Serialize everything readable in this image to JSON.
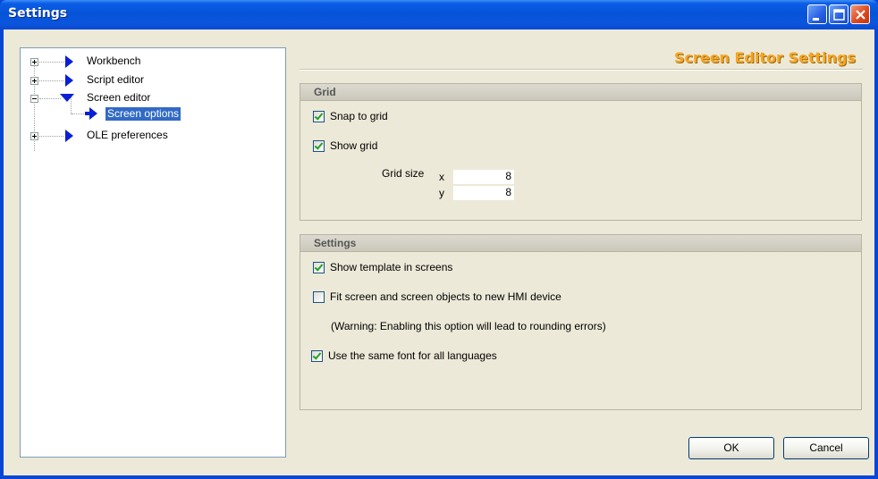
{
  "window": {
    "title": "Settings"
  },
  "tree": {
    "items": [
      {
        "label": "Workbench",
        "expander": "plus"
      },
      {
        "label": "Script editor",
        "expander": "plus"
      },
      {
        "label": "Screen editor",
        "expander": "minus"
      },
      {
        "label": "Screen options",
        "selected": true
      },
      {
        "label": "OLE preferences",
        "expander": "plus"
      }
    ]
  },
  "page": {
    "title": "Screen Editor Settings"
  },
  "grid_group": {
    "title": "Grid",
    "snap_to_grid": {
      "label": "Snap to grid",
      "checked": true
    },
    "show_grid": {
      "label": "Show grid",
      "checked": true
    },
    "grid_size_label": "Grid size",
    "x_label": "x",
    "y_label": "y",
    "x_value": "8",
    "y_value": "8"
  },
  "settings_group": {
    "title": "Settings",
    "show_template": {
      "label": "Show template in screens",
      "checked": true
    },
    "fit_screen": {
      "label": "Fit screen and screen objects to new HMI device",
      "checked": false
    },
    "warning": "(Warning: Enabling this option will lead to rounding errors)",
    "same_font": {
      "label": "Use the same font for all languages",
      "checked": true
    }
  },
  "buttons": {
    "ok": "OK",
    "cancel": "Cancel"
  },
  "colors": {
    "title_bar": "#0a5de6",
    "accent_title": "#f5a524",
    "selection": "#316ac5",
    "dialog_bg": "#ece9d8"
  }
}
